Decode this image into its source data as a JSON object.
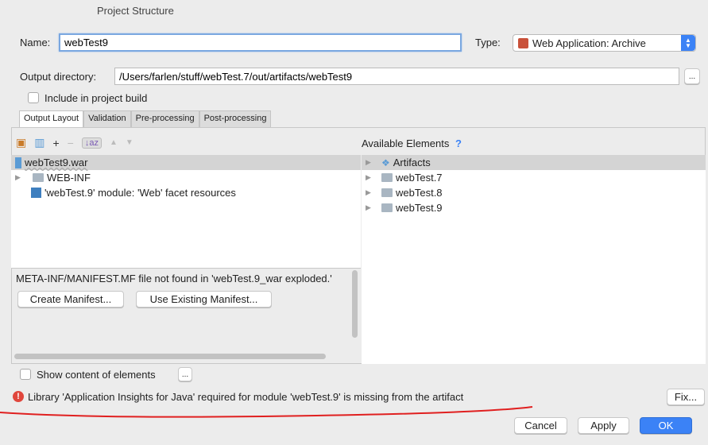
{
  "window": {
    "title": "Project Structure"
  },
  "name": {
    "label": "Name:",
    "value": "webTest9"
  },
  "type": {
    "label": "Type:",
    "value": "Web Application: Archive"
  },
  "output": {
    "label": "Output directory:",
    "value": "/Users/farlen/stuff/webTest.7/out/artifacts/webTest9",
    "browse": "..."
  },
  "include": {
    "label": "Include in project build",
    "checked": false
  },
  "tabs": [
    {
      "label": "Output Layout",
      "active": true
    },
    {
      "label": "Validation"
    },
    {
      "label": "Pre-processing"
    },
    {
      "label": "Post-processing"
    }
  ],
  "tree": {
    "items": [
      "webTest9.war",
      "WEB-INF",
      "'webTest.9' module: 'Web' facet resources"
    ]
  },
  "manifest": {
    "message": "META-INF/MANIFEST.MF file not found in 'webTest.9_war exploded.'",
    "create": "Create Manifest...",
    "use_existing": "Use Existing Manifest..."
  },
  "available": {
    "title": "Available Elements",
    "help": "?",
    "items": [
      "Artifacts",
      "webTest.7",
      "webTest.8",
      "webTest.9"
    ]
  },
  "show_content": {
    "label": "Show content of elements",
    "checked": false,
    "more": "..."
  },
  "error": {
    "message": "Library 'Application Insights for Java' required for module 'webTest.9' is missing from the artifact",
    "fix": "Fix..."
  },
  "footer": {
    "cancel": "Cancel",
    "apply": "Apply",
    "ok": "OK"
  },
  "colors": {
    "accent": "#3b82f6",
    "error": "#e0463c",
    "annotation": "#e02020"
  }
}
